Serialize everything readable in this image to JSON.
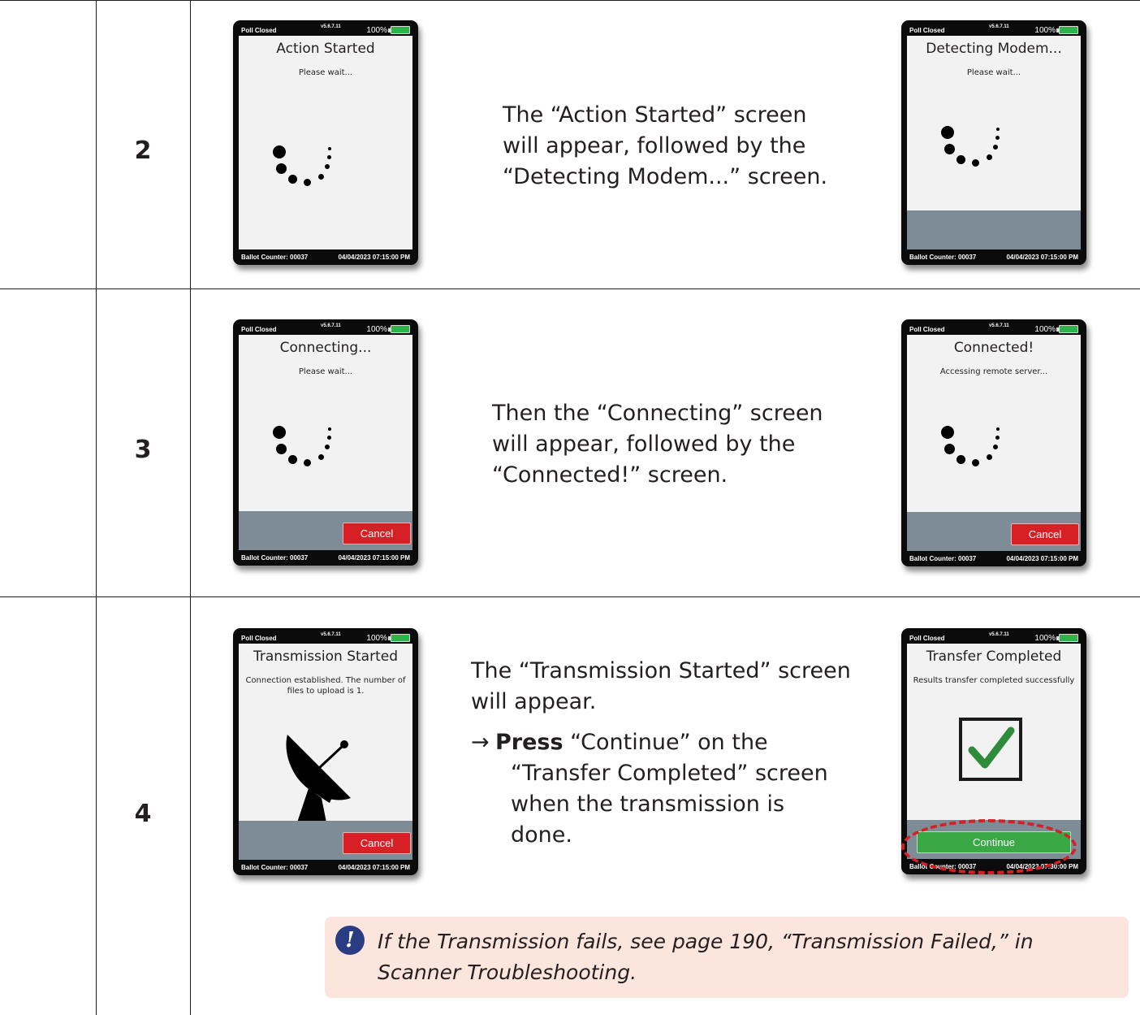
{
  "steps": [
    {
      "number": "2",
      "description_lines": [
        "The “Action Started” screen",
        "will appear, followed by the",
        "“Detecting Modem...” screen."
      ],
      "screens": [
        {
          "status": "Poll Closed",
          "version": "v5.6.7.11",
          "battery": "100%",
          "title": "Action Started",
          "subtitle": "Please wait...",
          "footer_left": "Ballot Counter: 00037",
          "footer_right": "04/04/2023  07:15:00 PM"
        },
        {
          "status": "Poll Closed",
          "version": "v5.6.7.11",
          "battery": "100%",
          "title": "Detecting Modem...",
          "subtitle": "Please wait...",
          "footer_left": "Ballot Counter: 00037",
          "footer_right": "04/04/2023  07:15:00 PM"
        }
      ]
    },
    {
      "number": "3",
      "description_lines": [
        "Then the “Connecting” screen",
        "will appear, followed by the",
        "“Connected!” screen."
      ],
      "screens": [
        {
          "status": "Poll Closed",
          "version": "v5.6.7.11",
          "battery": "100%",
          "title": "Connecting...",
          "subtitle": "Please wait...",
          "button": "Cancel",
          "footer_left": "Ballot Counter: 00037",
          "footer_right": "04/04/2023  07:15:00 PM"
        },
        {
          "status": "Poll Closed",
          "version": "v5.6.7.11",
          "battery": "100%",
          "title": "Connected!",
          "subtitle": "Accessing remote server...",
          "button": "Cancel",
          "footer_left": "Ballot Counter: 00037",
          "footer_right": "04/04/2023  07:15:00 PM"
        }
      ]
    },
    {
      "number": "4",
      "description_lines": [
        "The “Transmission Started” screen",
        "will appear."
      ],
      "bullet": {
        "arrow": "→",
        "press": "Press",
        "lines": [
          " “Continue” on the",
          "“Transfer Completed” screen",
          "when the transmission is",
          "done."
        ]
      },
      "screens": [
        {
          "status": "Poll Closed",
          "version": "v5.6.7.11",
          "battery": "100%",
          "title": "Transmission Started",
          "subtitle": "Connection established. The number of files to upload is 1.",
          "button": "Cancel",
          "icon": "satellite-dish-icon",
          "footer_left": "Ballot Counter: 00037",
          "footer_right": "04/04/2023  07:15:00 PM"
        },
        {
          "status": "Poll Closed",
          "version": "v5.6.7.11",
          "battery": "100%",
          "title": "Transfer Completed",
          "subtitle": "Results transfer completed successfully",
          "button": "Continue",
          "icon": "checkmark-icon",
          "footer_left": "Ballot Counter: 00037",
          "footer_right": "04/04/2023  07:30:00 PM"
        }
      ]
    }
  ],
  "note": {
    "icon": "!",
    "text": "If the Transmission fails, see page  190, “Transmission Failed,” in Scanner Troubleshooting."
  },
  "colors": {
    "cancel": "#d71f26",
    "continue": "#39a845",
    "bottom_bar": "#7d8c96",
    "note_bg": "#fbe5dc",
    "note_icon": "#2a3c82"
  }
}
